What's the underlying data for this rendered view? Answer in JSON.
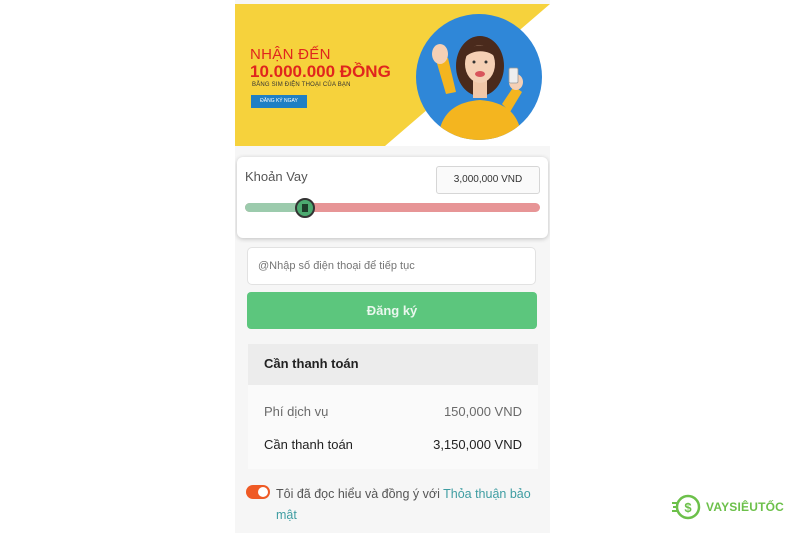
{
  "banner": {
    "title": "NHẬN ĐẾN",
    "amount": "10.000.000 ĐỒNG",
    "subtitle": "BẰNG SIM ĐIỆN THOẠI CỦA BẠN",
    "cta_label": "ĐĂNG KÝ NGAY"
  },
  "loan": {
    "label": "Khoản Vay",
    "amount": "3,000,000 VND",
    "slider_fraction": 0.2
  },
  "form": {
    "phone_placeholder": "@Nhập số điện thoại để tiếp tục",
    "register_label": "Đăng ký"
  },
  "payment": {
    "title": "Cần thanh toán",
    "rows": [
      {
        "label": "Phí dịch vụ",
        "value": "150,000 VND"
      },
      {
        "label": "Cần thanh toán",
        "value": "3,150,000 VND"
      }
    ]
  },
  "consent": {
    "text": "Tôi đã đọc hiểu và đồng ý với ",
    "link": "Thỏa thuận bảo mật",
    "checked": true
  },
  "watermark": {
    "brand": "VAYSIÊUTỐC"
  },
  "colors": {
    "banner_yellow": "#f6d23c",
    "banner_red": "#e0261d",
    "register_green": "#5cc67d",
    "slider_fill": "#9ccbad",
    "slider_rest": "#e79596",
    "toggle_on": "#ef5a25",
    "link_teal": "#3f9da2",
    "brand_green": "#6cc04a"
  }
}
